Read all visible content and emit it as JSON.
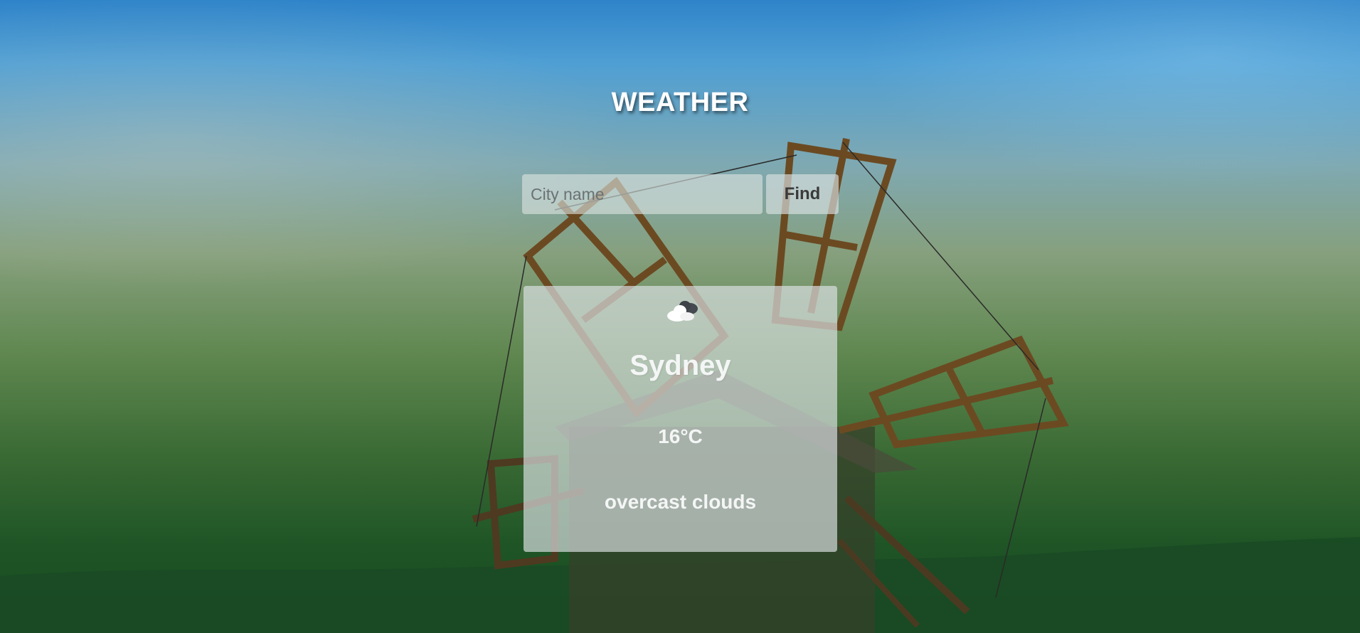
{
  "header": {
    "title": "WEATHER"
  },
  "search": {
    "placeholder": "City name",
    "value": "",
    "button_label": "Find"
  },
  "weather": {
    "icon": "overcast-clouds-icon",
    "city": "Sydney",
    "temperature": "16°C",
    "description": "overcast clouds"
  },
  "colors": {
    "sky_top": "#2f84c9",
    "ground": "#164a1f",
    "card_bg": "#dce2e4",
    "text_light": "#f4f6f6"
  }
}
